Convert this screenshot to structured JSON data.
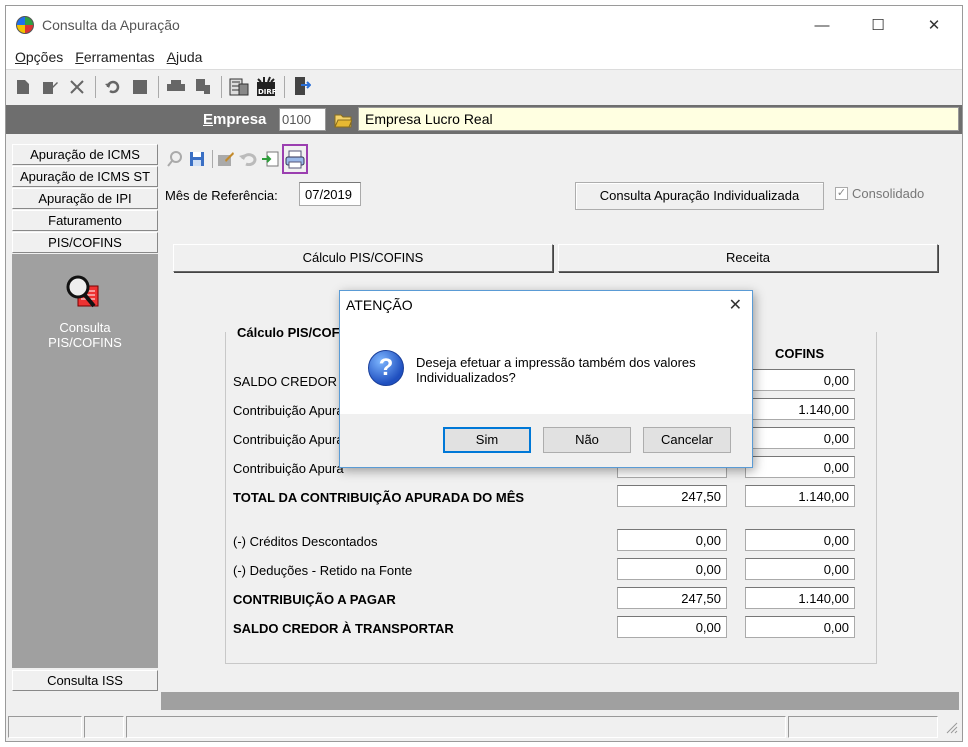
{
  "window": {
    "title": "Consulta da Apuração",
    "controls": {
      "minimize": "—",
      "maximize": "☐",
      "close": "✕"
    }
  },
  "menu": {
    "items": [
      "Opções",
      "Ferramentas",
      "Ajuda"
    ]
  },
  "empresa": {
    "label": "Empresa",
    "code": "0100",
    "name": "Empresa Lucro Real"
  },
  "sidebar": {
    "tabs": [
      "Apuração de ICMS",
      "Apuração de ICMS ST",
      "Apuração de IPI",
      "Faturamento",
      "PIS/COFINS"
    ],
    "panel_item": {
      "line1": "Consulta",
      "line2": "PIS/COFINS"
    },
    "bottom_tab": "Consulta ISS"
  },
  "form": {
    "ref_label": "Mês de Referência:",
    "ref_value": "07/2019",
    "consulta_button": "Consulta Apuração Individualizada",
    "consolidado_label": "Consolidado",
    "consolidado_checked": true,
    "tabs": [
      "Cálculo PIS/COFINS",
      "Receita"
    ]
  },
  "group": {
    "title": "Cálculo PIS/COF",
    "col_cofins": "COFINS",
    "rows": [
      {
        "label": "SALDO CREDOR PE",
        "pis": "",
        "cofins": "0,00"
      },
      {
        "label": "Contribuição Apura",
        "pis": "",
        "cofins": "1.140,00"
      },
      {
        "label": "Contribuição Apura",
        "pis": "",
        "cofins": "0,00"
      },
      {
        "label": "Contribuição Apura",
        "pis": "",
        "cofins": "0,00"
      },
      {
        "label": "TOTAL DA CONTRIBUIÇÃO APURADA DO MÊS",
        "pis": "247,50",
        "cofins": "1.140,00"
      },
      {
        "label": "(-) Créditos Descontados",
        "pis": "0,00",
        "cofins": "0,00"
      },
      {
        "label": "(-) Deduções - Retido na Fonte",
        "pis": "0,00",
        "cofins": "0,00"
      },
      {
        "label": "CONTRIBUIÇÃO A PAGAR",
        "pis": "247,50",
        "cofins": "1.140,00"
      },
      {
        "label": "SALDO CREDOR À TRANSPORTAR",
        "pis": "0,00",
        "cofins": "0,00"
      }
    ]
  },
  "dialog": {
    "title": "ATENÇÃO",
    "close": "✕",
    "icon": "?",
    "message_line1": "Deseja efetuar a impressão também dos valores",
    "message_line2": "Individualizados?",
    "buttons": {
      "yes": "Sim",
      "no": "Não",
      "cancel": "Cancelar"
    }
  },
  "colors": {
    "accent": "#0078d7",
    "highlight": "#9b3fb0",
    "panel": "#a0a0a0",
    "empresa_bar": "#6e6e6e"
  }
}
